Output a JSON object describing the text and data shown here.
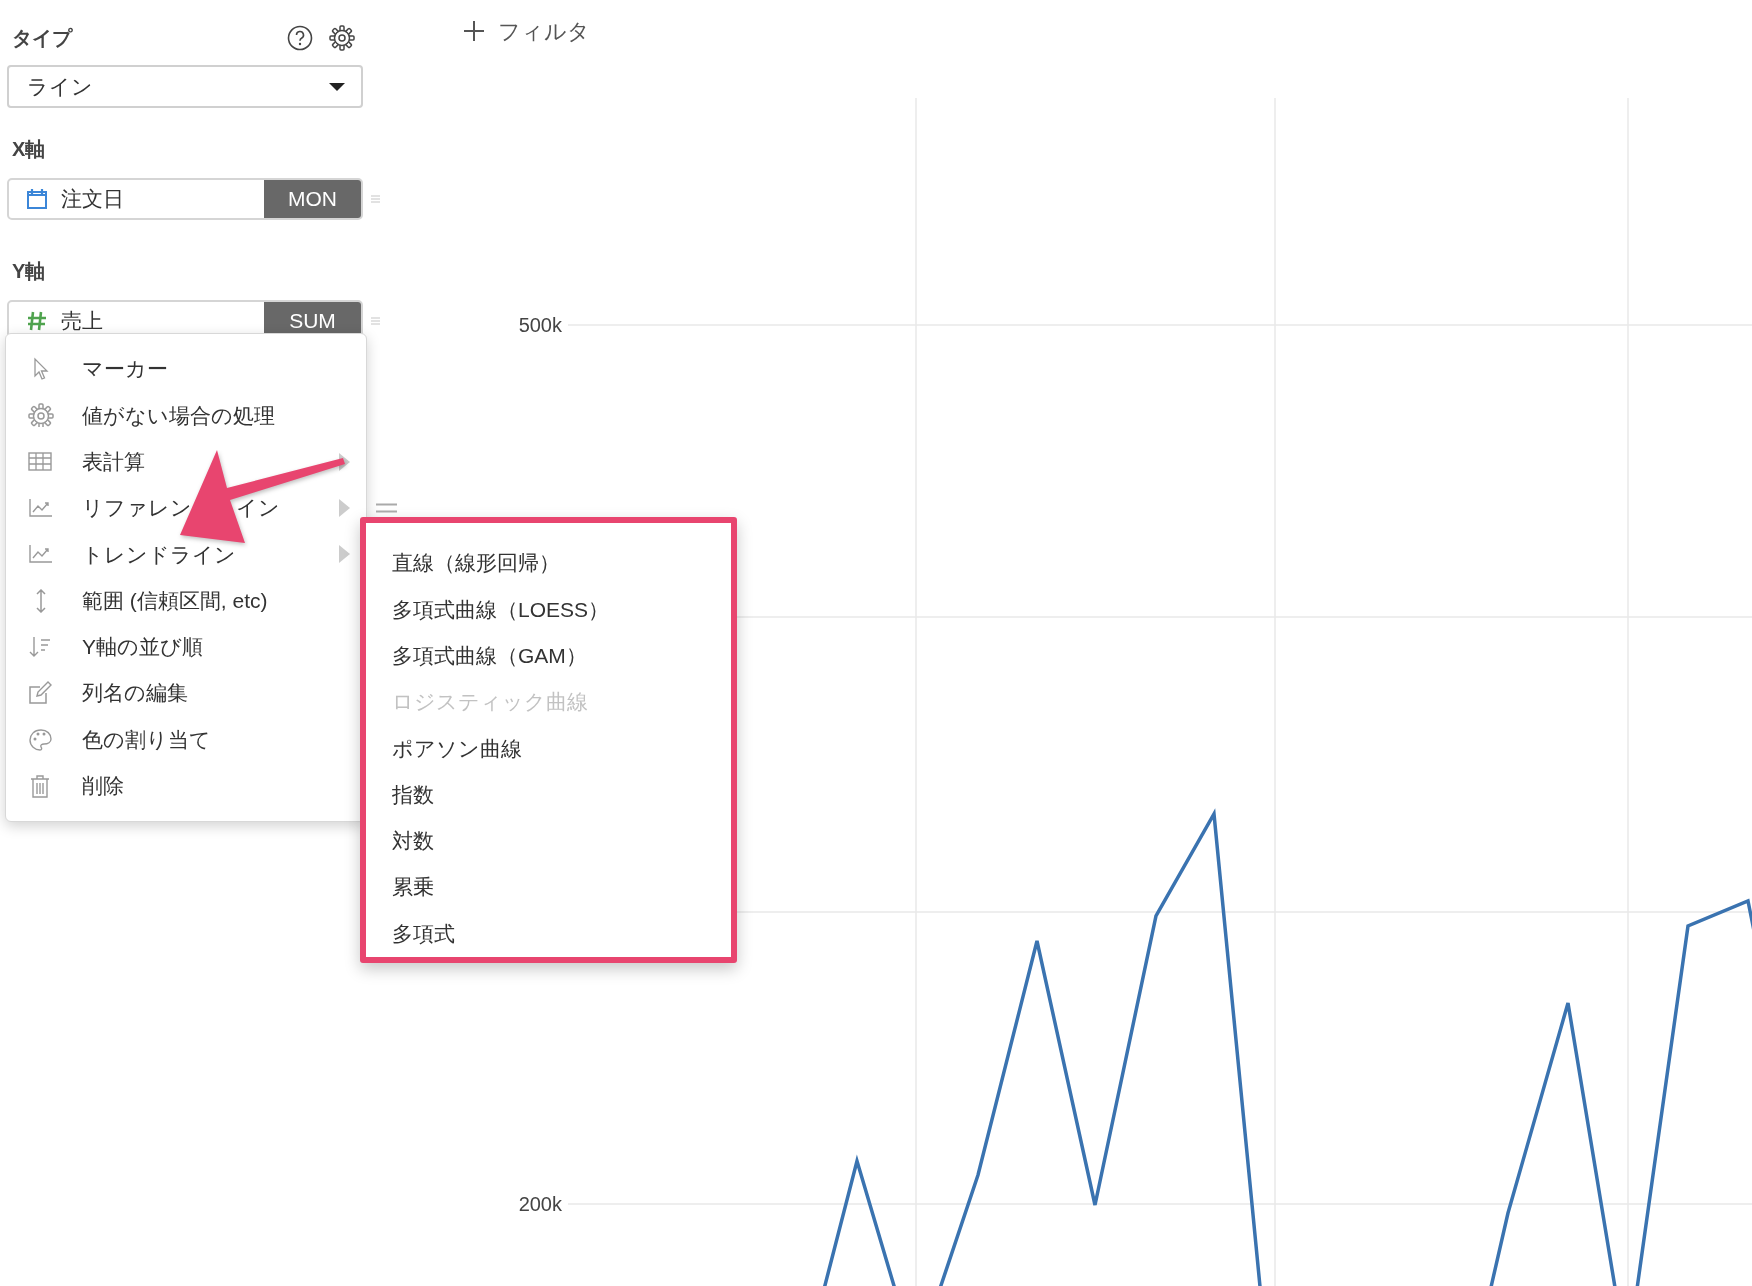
{
  "sidebar": {
    "type_label": "タイプ",
    "chart_type": {
      "value": "ライン"
    },
    "x_axis": {
      "label": "X軸",
      "field": "注文日",
      "aggregation": "MON"
    },
    "y_axis": {
      "label": "Y軸",
      "field": "売上",
      "aggregation": "SUM"
    }
  },
  "filter_button": {
    "label": "フィルタ"
  },
  "context_menu": {
    "items": [
      {
        "label": "マーカー",
        "submenu": false
      },
      {
        "label": "値がない場合の処理",
        "submenu": false
      },
      {
        "label": "表計算",
        "submenu": true
      },
      {
        "label": "リファレン",
        "label_end": "イン",
        "submenu": true
      },
      {
        "label": "トレンドライン",
        "submenu": true
      },
      {
        "label": "範囲 (信頼区間, etc)",
        "submenu": false
      },
      {
        "label": "Y軸の並び順",
        "submenu": false
      },
      {
        "label": "列名の編集",
        "submenu": false
      },
      {
        "label": "色の割り当て",
        "submenu": false
      },
      {
        "label": "削除",
        "submenu": false
      }
    ]
  },
  "submenu": {
    "items": [
      {
        "label": "直線（線形回帰）",
        "disabled": false
      },
      {
        "label": "多項式曲線（LOESS）",
        "disabled": false
      },
      {
        "label": "多項式曲線（GAM）",
        "disabled": false
      },
      {
        "label": "ロジスティック曲線",
        "disabled": true
      },
      {
        "label": "ポアソン曲線",
        "disabled": false
      },
      {
        "label": "指数",
        "disabled": false
      },
      {
        "label": "対数",
        "disabled": false
      },
      {
        "label": "累乗",
        "disabled": false
      },
      {
        "label": "多項式",
        "disabled": false
      }
    ]
  },
  "chart": {
    "y_tick_labels": [
      "500k",
      "200k"
    ]
  }
}
